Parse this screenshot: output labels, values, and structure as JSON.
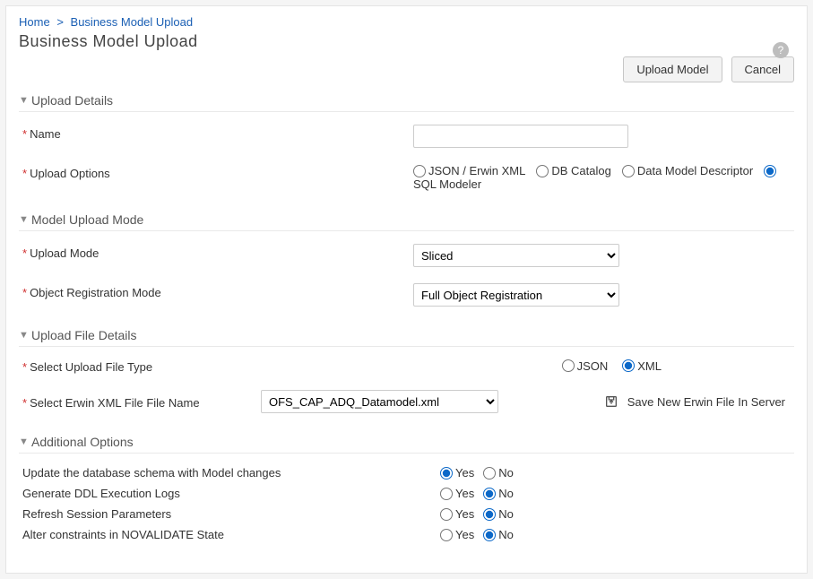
{
  "breadcrumb": {
    "home": "Home",
    "current": "Business Model Upload"
  },
  "page_title": "Business Model Upload",
  "actions": {
    "upload": "Upload Model",
    "cancel": "Cancel"
  },
  "sections": {
    "upload_details": {
      "title": "Upload Details",
      "name_label": "Name",
      "upload_options_label": "Upload Options",
      "options": {
        "json_erwin": "JSON / Erwin XML",
        "db_catalog": "DB Catalog",
        "dmd": "Data Model Descriptor",
        "sql_modeler": "SQL Modeler"
      }
    },
    "model_upload_mode": {
      "title": "Model Upload Mode",
      "upload_mode_label": "Upload Mode",
      "upload_mode_value": "Sliced",
      "object_reg_label": "Object Registration Mode",
      "object_reg_value": "Full Object Registration"
    },
    "upload_file_details": {
      "title": "Upload File Details",
      "file_type_label": "Select Upload File Type",
      "file_type_options": {
        "json": "JSON",
        "xml": "XML"
      },
      "erwin_file_label": "Select Erwin XML File File Name",
      "erwin_file_value": "OFS_CAP_ADQ_Datamodel.xml",
      "save_new_file": "Save New Erwin File In Server"
    },
    "additional_options": {
      "title": "Additional Options",
      "yes": "Yes",
      "no": "No",
      "rows": {
        "update_schema": "Update the database schema with Model changes",
        "gen_ddl": "Generate DDL Execution Logs",
        "refresh_session": "Refresh Session Parameters",
        "alter_constraints": "Alter constraints in NOVALIDATE State"
      }
    }
  }
}
